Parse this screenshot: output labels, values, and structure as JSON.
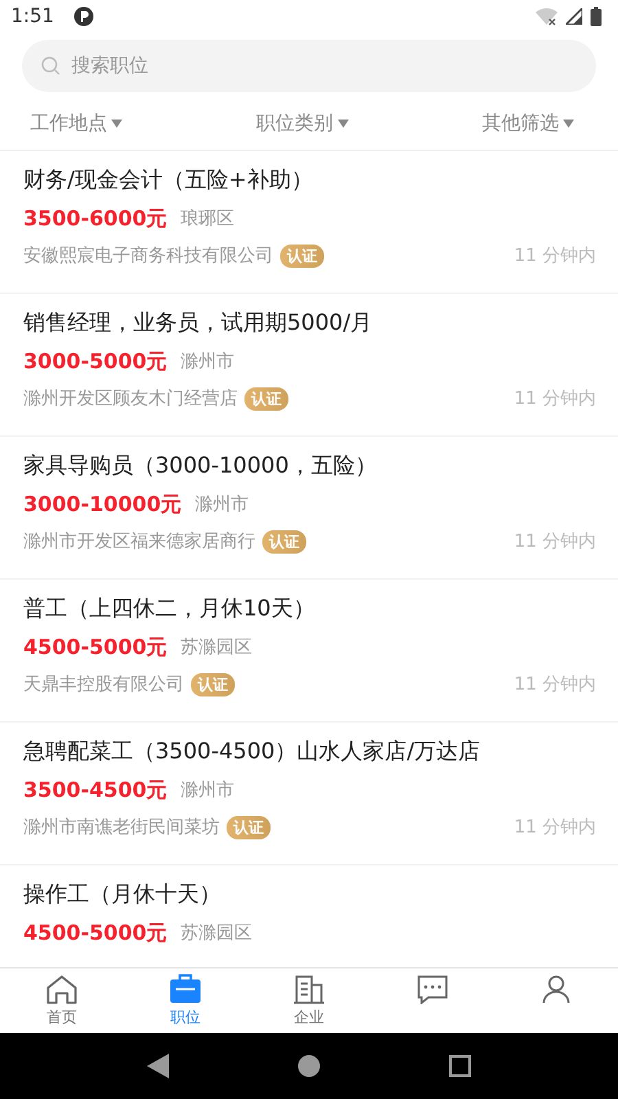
{
  "status_bar": {
    "time": "1:51"
  },
  "search": {
    "placeholder": "搜索职位"
  },
  "filters": [
    {
      "label": "工作地点"
    },
    {
      "label": "职位类别"
    },
    {
      "label": "其他筛选"
    }
  ],
  "jobs": [
    {
      "title": "财务/现金会计（五险+补助）",
      "salary": "3500-6000元",
      "area": "琅琊区",
      "company": "安徽熙宸电子商务科技有限公司",
      "verified": true,
      "badge": "认证",
      "time": "11 分钟内"
    },
    {
      "title": "销售经理，业务员，试用期5000/月",
      "salary": "3000-5000元",
      "area": "滁州市",
      "company": "滁州开发区顾友木门经营店",
      "verified": true,
      "badge": "认证",
      "time": "11 分钟内"
    },
    {
      "title": "家具导购员（3000-10000，五险）",
      "salary": "3000-10000元",
      "area": "滁州市",
      "company": "滁州市开发区福来德家居商行",
      "verified": true,
      "badge": "认证",
      "time": "11 分钟内"
    },
    {
      "title": "普工（上四休二，月休10天）",
      "salary": "4500-5000元",
      "area": "苏滁园区",
      "company": "天鼎丰控股有限公司",
      "verified": true,
      "badge": "认证",
      "time": "11 分钟内"
    },
    {
      "title": "急聘配菜工（3500-4500）山水人家店/万达店",
      "salary": "3500-4500元",
      "area": "滁州市",
      "company": "滁州市南谯老街民间菜坊",
      "verified": true,
      "badge": "认证",
      "time": "11 分钟内"
    },
    {
      "title": "操作工（月休十天）",
      "salary": "4500-5000元",
      "area": "苏滁园区"
    }
  ],
  "tab_bar": [
    {
      "kind": "home",
      "label": "首页",
      "selected": false
    },
    {
      "kind": "jobs",
      "label": "职位",
      "selected": true
    },
    {
      "kind": "company",
      "label": "企业",
      "selected": false
    },
    {
      "kind": "messages",
      "selected": false
    },
    {
      "kind": "profile",
      "selected": false
    }
  ]
}
